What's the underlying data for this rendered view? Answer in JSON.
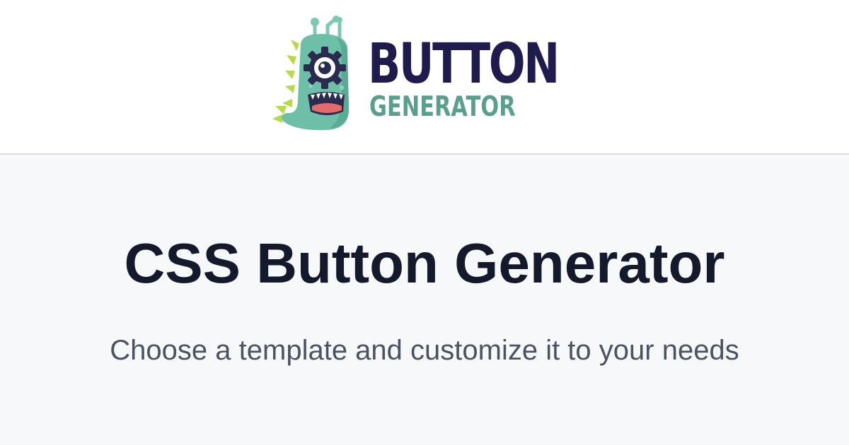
{
  "logo": {
    "word_top": "BUTTON",
    "word_bottom": "GENERATOR",
    "mascot_icon": "monster-gear-eye-mascot",
    "colors": {
      "navy": "#1f1b4d",
      "teal": "#5a9e8d",
      "mascot_body": "#6dbfa8",
      "mascot_spikes": "#b8d94a"
    }
  },
  "hero": {
    "title": "CSS Button Generator",
    "subtitle": "Choose a template and customize it to your needs"
  },
  "colors": {
    "header_bg": "#ffffff",
    "hero_bg": "#f7f8fa",
    "divider": "#d9dbe0",
    "title": "#141a2b",
    "subtitle": "#4b5363"
  }
}
